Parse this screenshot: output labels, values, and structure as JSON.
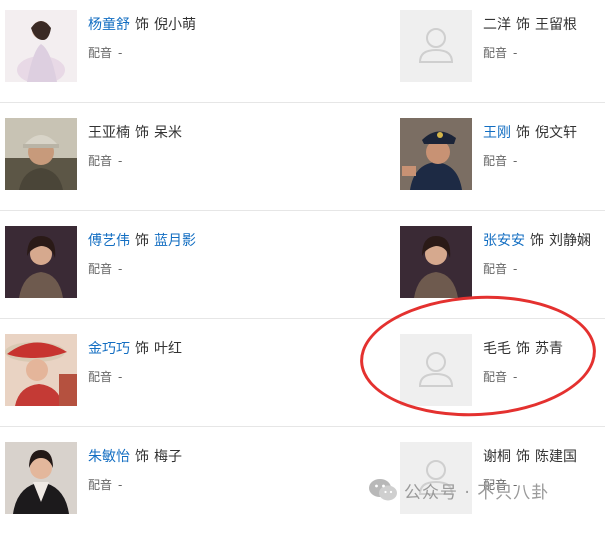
{
  "cast": [
    {
      "left": {
        "actor": "杨童舒",
        "sep": "饰",
        "role": "倪小萌",
        "actor_linked": true,
        "role_linked": false,
        "voice_label": "配音",
        "voice_value": "-",
        "photo": "woman-white-dress-photo"
      },
      "right": {
        "actor": "二洋",
        "sep": "饰",
        "role": "王留根",
        "actor_linked": false,
        "role_linked": false,
        "voice_label": "配音",
        "voice_value": "-",
        "photo": "placeholder-avatar"
      }
    },
    {
      "left": {
        "actor": "王亚楠",
        "sep": "饰",
        "role": "呆米",
        "actor_linked": false,
        "role_linked": false,
        "voice_label": "配音",
        "voice_value": "-",
        "photo": "man-cap-photo"
      },
      "right": {
        "actor": "王刚",
        "sep": "饰",
        "role": "倪文轩",
        "actor_linked": true,
        "role_linked": false,
        "voice_label": "配音",
        "voice_value": "-",
        "photo": "police-officer-photo"
      }
    },
    {
      "left": {
        "actor": "傅艺伟",
        "sep": "饰",
        "role": "蓝月影",
        "actor_linked": true,
        "role_linked": true,
        "voice_label": "配音",
        "voice_value": "-",
        "photo": "woman-dark-photo"
      },
      "right": {
        "actor": "张安安",
        "sep": "饰",
        "role": "刘静娴",
        "actor_linked": true,
        "role_linked": false,
        "voice_label": "配音",
        "voice_value": "-",
        "photo": "woman-dark-photo"
      }
    },
    {
      "left": {
        "actor": "金巧巧",
        "sep": "饰",
        "role": "叶红",
        "actor_linked": true,
        "role_linked": false,
        "voice_label": "配音",
        "voice_value": "-",
        "photo": "woman-red-hat-photo"
      },
      "right": {
        "actor": "毛毛",
        "sep": "饰",
        "role": "苏青",
        "actor_linked": false,
        "role_linked": false,
        "voice_label": "配音",
        "voice_value": "-",
        "photo": "placeholder-avatar"
      }
    },
    {
      "left": {
        "actor": "朱敏怡",
        "sep": "饰",
        "role": "梅子",
        "actor_linked": true,
        "role_linked": false,
        "voice_label": "配音",
        "voice_value": "-",
        "photo": "woman-black-coat-photo"
      },
      "right": {
        "actor": "谢桐",
        "sep": "饰",
        "role": "陈建国",
        "actor_linked": false,
        "role_linked": false,
        "voice_label": "配音",
        "voice_value": "-",
        "photo": "placeholder-avatar"
      }
    }
  ],
  "watermark": {
    "text": "公众号 · 不只八卦",
    "icon": "wechat-icon"
  },
  "annotation": {
    "color": "#e4312f",
    "shape": "hand-drawn-ellipse"
  },
  "colors": {
    "link": "#136ec2",
    "text": "#333333",
    "muted": "#666666",
    "divider": "#e6e6e6"
  }
}
